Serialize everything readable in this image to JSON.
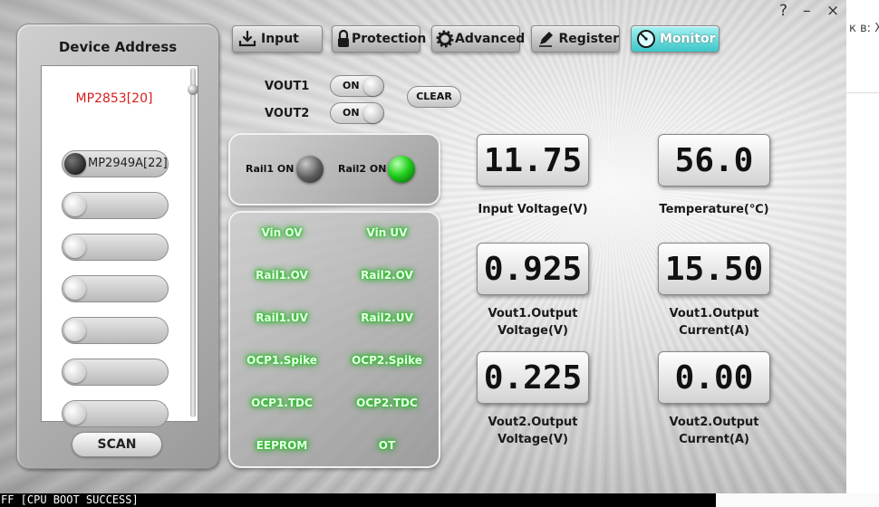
{
  "window": {
    "controls": {
      "help": "?",
      "minimize": "–",
      "close": "×"
    }
  },
  "device_panel": {
    "title": "Device Address",
    "selected_device": "MP2853[20]",
    "devices": [
      {
        "label": "MP2949A[22]",
        "active": true
      },
      {
        "label": "",
        "active": false
      },
      {
        "label": "",
        "active": false
      },
      {
        "label": "",
        "active": false
      },
      {
        "label": "",
        "active": false
      },
      {
        "label": "",
        "active": false
      },
      {
        "label": "",
        "active": false
      }
    ],
    "scan_label": "SCAN"
  },
  "tabs": [
    {
      "label": "Input",
      "icon": "download-icon",
      "active": false
    },
    {
      "label": "Protection",
      "icon": "lock-icon",
      "active": false
    },
    {
      "label": "Advanced",
      "icon": "gear-icon",
      "active": false
    },
    {
      "label": "Register",
      "icon": "pencil-icon",
      "active": false
    },
    {
      "label": "Monitor",
      "icon": "gauge-icon",
      "active": true
    }
  ],
  "outputs": {
    "vout1": {
      "label": "VOUT1",
      "state": "ON"
    },
    "vout2": {
      "label": "VOUT2",
      "state": "ON"
    },
    "clear_label": "CLEAR"
  },
  "rails": {
    "rail1": {
      "label": "Rail1 ON",
      "status": "off"
    },
    "rail2": {
      "label": "Rail2 ON",
      "status": "on"
    }
  },
  "protection_flags": [
    "Vin OV",
    "Vin UV",
    "Rail1.OV",
    "Rail2.OV",
    "Rail1.UV",
    "Rail2.UV",
    "OCP1.Spike",
    "OCP2.Spike",
    "OCP1.TDC",
    "OCP2.TDC",
    "EEPROM",
    "OT"
  ],
  "readings": {
    "input_voltage": {
      "value": "11.75",
      "label": "Input Voltage(V)"
    },
    "temperature": {
      "value": "56.0",
      "label": "Temperature(℃)"
    },
    "vout1_voltage": {
      "value": "0.925",
      "label_line1": "Vout1.Output",
      "label_line2": "Voltage(V)"
    },
    "vout1_current": {
      "value": "15.50",
      "label_line1": "Vout1.Output",
      "label_line2": "Current(A)"
    },
    "vout2_voltage": {
      "value": "0.225",
      "label_line1": "Vout2.Output",
      "label_line2": "Voltage(V)"
    },
    "vout2_current": {
      "value": "0.00",
      "label_line1": "Vout2.Output",
      "label_line2": "Current(A)"
    }
  },
  "background_text": {
    "right_fragment": "к в: Хь",
    "console_line": "FF [CPU BOOT SUCCESS]"
  }
}
